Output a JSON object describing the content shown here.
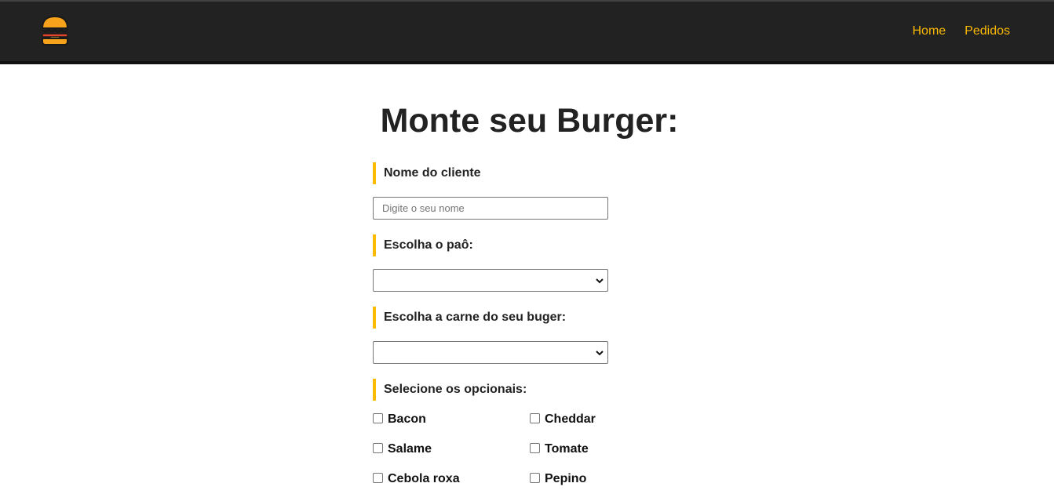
{
  "header": {
    "logo_icon": "burger-icon",
    "nav": [
      {
        "label": "Home"
      },
      {
        "label": "Pedidos"
      }
    ]
  },
  "main": {
    "title": "Monte seu Burger:",
    "form": {
      "name_label": "Nome do cliente",
      "name_placeholder": "Digite o seu nome",
      "name_value": "",
      "bread_label": "Escolha o paô:",
      "bread_selected": "",
      "meat_label": "Escolha a carne do seu buger:",
      "meat_selected": "",
      "optionals_label": "Selecione os opcionais:",
      "optionals": [
        {
          "label": "Bacon",
          "checked": false
        },
        {
          "label": "Cheddar",
          "checked": false
        },
        {
          "label": "Salame",
          "checked": false
        },
        {
          "label": "Tomate",
          "checked": false
        },
        {
          "label": "Cebola roxa",
          "checked": false
        },
        {
          "label": "Pepino",
          "checked": false
        }
      ]
    }
  },
  "colors": {
    "navbar_bg": "#222222",
    "accent": "#fcba03",
    "text": "#222222"
  }
}
